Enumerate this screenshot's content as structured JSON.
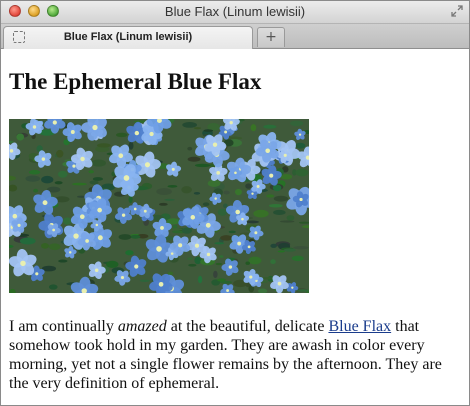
{
  "window": {
    "title": "Blue Flax (Linum lewisii)",
    "traffic_lights": [
      "close",
      "minimize",
      "zoom"
    ],
    "fullscreen_icon": "fullscreen-arrows-icon"
  },
  "tabs": [
    {
      "label": "Blue Flax (Linum lewisii)",
      "favicon": "placeholder-favicon-icon",
      "active": true
    }
  ],
  "new_tab_symbol": "+",
  "page": {
    "heading": "The Ephemeral Blue Flax",
    "image": {
      "subject": "blue flax flowers photo"
    },
    "paragraph": {
      "part1": "I am continually ",
      "emphasis": "amazed",
      "part2": " at the beautiful, delicate ",
      "link_text": "Blue Flax",
      "part3": " that somehow took hold in my garden. They are awash in color every morning, yet not a single flower remains by the afternoon. They are the very definition of ephemeral."
    }
  },
  "colors": {
    "link": "#1a3c8c",
    "flower": "#7aa6e8",
    "foliage": "#3f5a3a"
  }
}
